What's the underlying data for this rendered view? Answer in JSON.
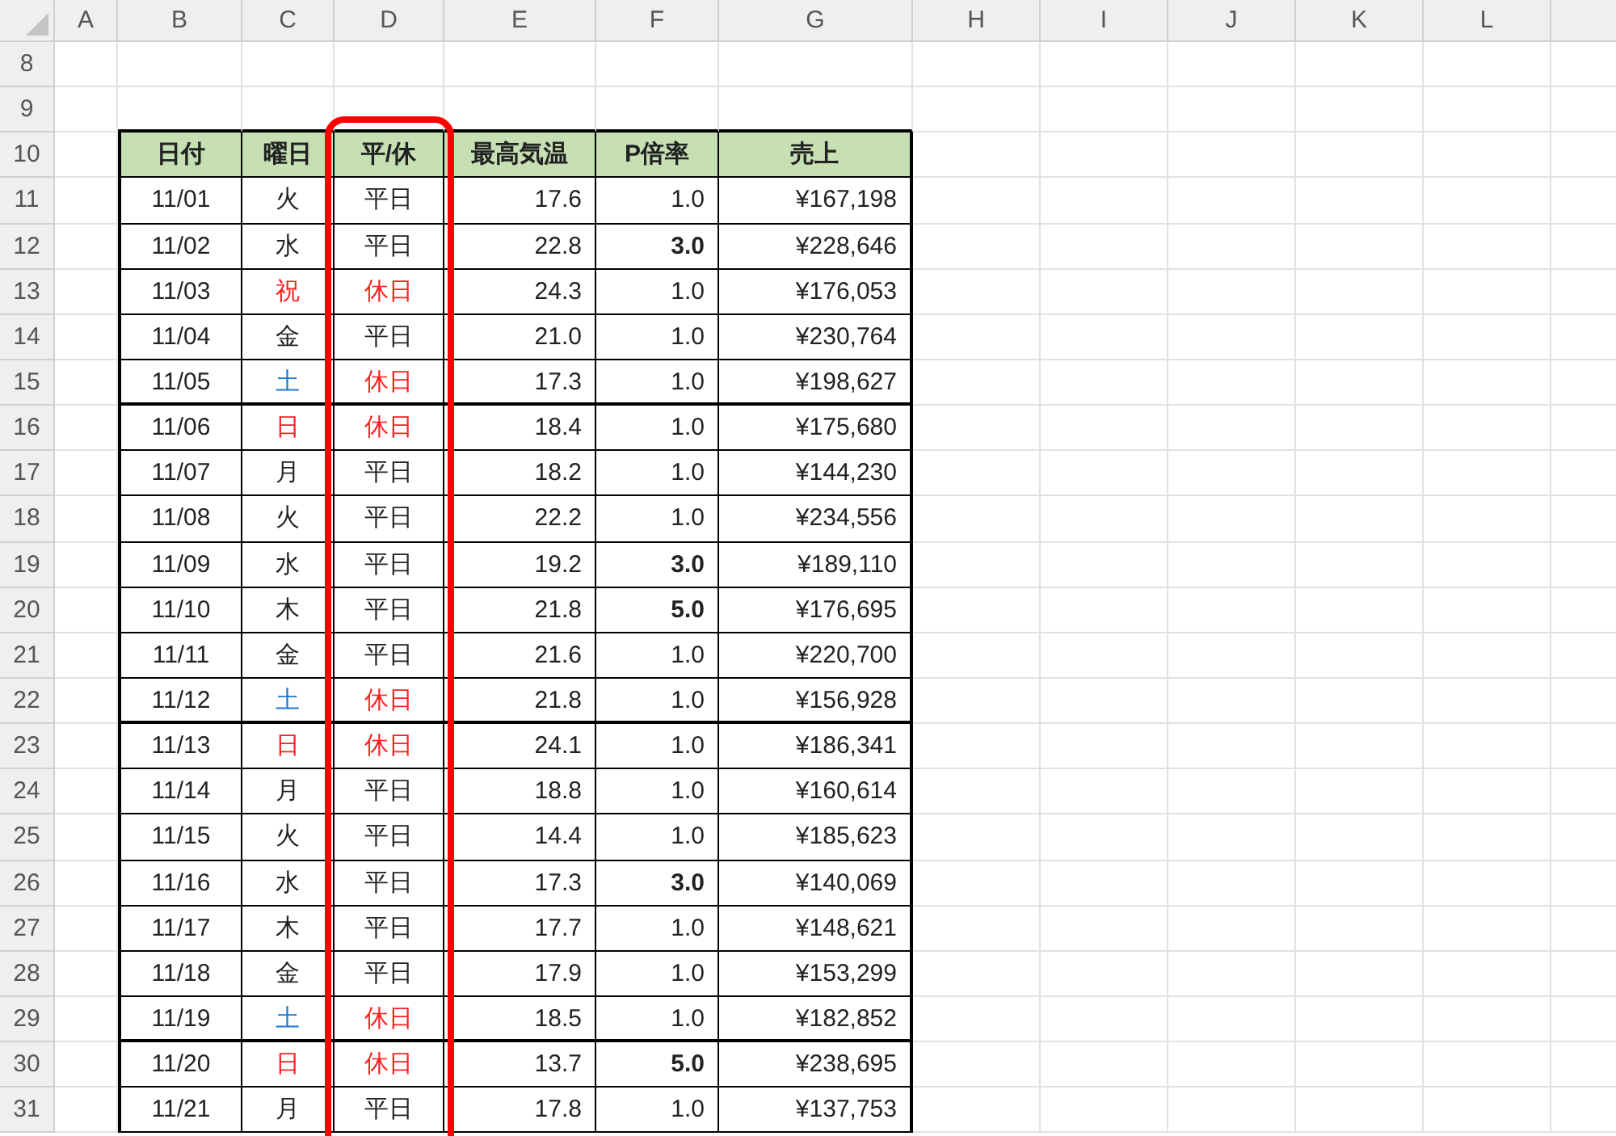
{
  "column_headers": [
    "A",
    "B",
    "C",
    "D",
    "E",
    "F",
    "G",
    "H",
    "I",
    "J",
    "K",
    "L"
  ],
  "row_headers": [
    "8",
    "9",
    "10",
    "11",
    "12",
    "13",
    "14",
    "15",
    "16",
    "17",
    "18",
    "19",
    "20",
    "21",
    "22",
    "23",
    "24",
    "25",
    "26",
    "27",
    "28",
    "29",
    "30",
    "31"
  ],
  "table": {
    "columns": [
      "日付",
      "曜日",
      "平/休",
      "最高気温",
      "P倍率",
      "売上"
    ],
    "rows": [
      {
        "date": "11/01",
        "weekday": {
          "label": "火",
          "color": "#222222"
        },
        "day_type": {
          "label": "平日",
          "color": "#222222"
        },
        "max_temp": "17.6",
        "points": "1.0",
        "highlighted": false,
        "sales": "¥167,198",
        "week_divider": false
      },
      {
        "date": "11/02",
        "weekday": {
          "label": "水",
          "color": "#222222"
        },
        "day_type": {
          "label": "平日",
          "color": "#222222"
        },
        "max_temp": "22.8",
        "points": "3.0",
        "highlighted": true,
        "sales": "¥228,646",
        "week_divider": false
      },
      {
        "date": "11/03",
        "weekday": {
          "label": "祝",
          "color": "#ff2020"
        },
        "day_type": {
          "label": "休日",
          "color": "#ff2020"
        },
        "max_temp": "24.3",
        "points": "1.0",
        "highlighted": false,
        "sales": "¥176,053",
        "week_divider": false
      },
      {
        "date": "11/04",
        "weekday": {
          "label": "金",
          "color": "#222222"
        },
        "day_type": {
          "label": "平日",
          "color": "#222222"
        },
        "max_temp": "21.0",
        "points": "1.0",
        "highlighted": false,
        "sales": "¥230,764",
        "week_divider": false
      },
      {
        "date": "11/05",
        "weekday": {
          "label": "土",
          "color": "#1e78d2"
        },
        "day_type": {
          "label": "休日",
          "color": "#ff2020"
        },
        "max_temp": "17.3",
        "points": "1.0",
        "highlighted": false,
        "sales": "¥198,627",
        "week_divider": true
      },
      {
        "date": "11/06",
        "weekday": {
          "label": "日",
          "color": "#ff2020"
        },
        "day_type": {
          "label": "休日",
          "color": "#ff2020"
        },
        "max_temp": "18.4",
        "points": "1.0",
        "highlighted": false,
        "sales": "¥175,680",
        "week_divider": false
      },
      {
        "date": "11/07",
        "weekday": {
          "label": "月",
          "color": "#222222"
        },
        "day_type": {
          "label": "平日",
          "color": "#222222"
        },
        "max_temp": "18.2",
        "points": "1.0",
        "highlighted": false,
        "sales": "¥144,230",
        "week_divider": false
      },
      {
        "date": "11/08",
        "weekday": {
          "label": "火",
          "color": "#222222"
        },
        "day_type": {
          "label": "平日",
          "color": "#222222"
        },
        "max_temp": "22.2",
        "points": "1.0",
        "highlighted": false,
        "sales": "¥234,556",
        "week_divider": false
      },
      {
        "date": "11/09",
        "weekday": {
          "label": "水",
          "color": "#222222"
        },
        "day_type": {
          "label": "平日",
          "color": "#222222"
        },
        "max_temp": "19.2",
        "points": "3.0",
        "highlighted": true,
        "sales": "¥189,110",
        "week_divider": false
      },
      {
        "date": "11/10",
        "weekday": {
          "label": "木",
          "color": "#222222"
        },
        "day_type": {
          "label": "平日",
          "color": "#222222"
        },
        "max_temp": "21.8",
        "points": "5.0",
        "highlighted": true,
        "sales": "¥176,695",
        "week_divider": false
      },
      {
        "date": "11/11",
        "weekday": {
          "label": "金",
          "color": "#222222"
        },
        "day_type": {
          "label": "平日",
          "color": "#222222"
        },
        "max_temp": "21.6",
        "points": "1.0",
        "highlighted": false,
        "sales": "¥220,700",
        "week_divider": false
      },
      {
        "date": "11/12",
        "weekday": {
          "label": "土",
          "color": "#1e78d2"
        },
        "day_type": {
          "label": "休日",
          "color": "#ff2020"
        },
        "max_temp": "21.8",
        "points": "1.0",
        "highlighted": false,
        "sales": "¥156,928",
        "week_divider": true
      },
      {
        "date": "11/13",
        "weekday": {
          "label": "日",
          "color": "#ff2020"
        },
        "day_type": {
          "label": "休日",
          "color": "#ff2020"
        },
        "max_temp": "24.1",
        "points": "1.0",
        "highlighted": false,
        "sales": "¥186,341",
        "week_divider": false
      },
      {
        "date": "11/14",
        "weekday": {
          "label": "月",
          "color": "#222222"
        },
        "day_type": {
          "label": "平日",
          "color": "#222222"
        },
        "max_temp": "18.8",
        "points": "1.0",
        "highlighted": false,
        "sales": "¥160,614",
        "week_divider": false
      },
      {
        "date": "11/15",
        "weekday": {
          "label": "火",
          "color": "#222222"
        },
        "day_type": {
          "label": "平日",
          "color": "#222222"
        },
        "max_temp": "14.4",
        "points": "1.0",
        "highlighted": false,
        "sales": "¥185,623",
        "week_divider": false
      },
      {
        "date": "11/16",
        "weekday": {
          "label": "水",
          "color": "#222222"
        },
        "day_type": {
          "label": "平日",
          "color": "#222222"
        },
        "max_temp": "17.3",
        "points": "3.0",
        "highlighted": true,
        "sales": "¥140,069",
        "week_divider": false
      },
      {
        "date": "11/17",
        "weekday": {
          "label": "木",
          "color": "#222222"
        },
        "day_type": {
          "label": "平日",
          "color": "#222222"
        },
        "max_temp": "17.7",
        "points": "1.0",
        "highlighted": false,
        "sales": "¥148,621",
        "week_divider": false
      },
      {
        "date": "11/18",
        "weekday": {
          "label": "金",
          "color": "#222222"
        },
        "day_type": {
          "label": "平日",
          "color": "#222222"
        },
        "max_temp": "17.9",
        "points": "1.0",
        "highlighted": false,
        "sales": "¥153,299",
        "week_divider": false
      },
      {
        "date": "11/19",
        "weekday": {
          "label": "土",
          "color": "#1e78d2"
        },
        "day_type": {
          "label": "休日",
          "color": "#ff2020"
        },
        "max_temp": "18.5",
        "points": "1.0",
        "highlighted": false,
        "sales": "¥182,852",
        "week_divider": true
      },
      {
        "date": "11/20",
        "weekday": {
          "label": "日",
          "color": "#ff2020"
        },
        "day_type": {
          "label": "休日",
          "color": "#ff2020"
        },
        "max_temp": "13.7",
        "points": "5.0",
        "highlighted": true,
        "sales": "¥238,695",
        "week_divider": false
      },
      {
        "date": "11/21",
        "weekday": {
          "label": "月",
          "color": "#222222"
        },
        "day_type": {
          "label": "平日",
          "color": "#222222"
        },
        "max_temp": "17.8",
        "points": "1.0",
        "highlighted": false,
        "sales": "¥137,753",
        "week_divider": false
      }
    ]
  }
}
